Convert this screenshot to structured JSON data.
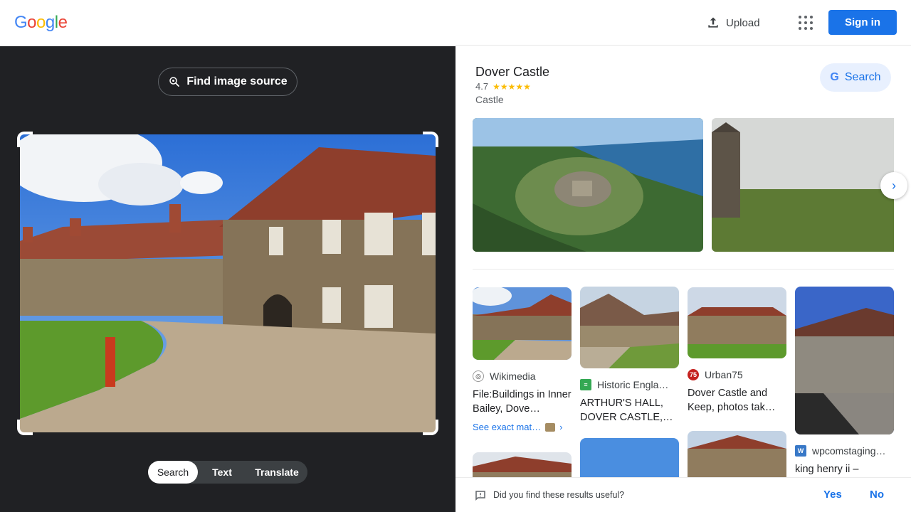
{
  "header": {
    "logo_letters": [
      {
        "ch": "G",
        "color": "#4285F4"
      },
      {
        "ch": "o",
        "color": "#EA4335"
      },
      {
        "ch": "o",
        "color": "#FBBC05"
      },
      {
        "ch": "g",
        "color": "#4285F4"
      },
      {
        "ch": "l",
        "color": "#34A853"
      },
      {
        "ch": "e",
        "color": "#EA4335"
      }
    ],
    "upload_label": "Upload",
    "apps_icon": "apps-grid-icon",
    "signin_label": "Sign in"
  },
  "left": {
    "find_source_label": "Find image source",
    "modes": [
      "Search",
      "Text",
      "Translate"
    ],
    "active_mode": "Search"
  },
  "knowledge_panel": {
    "title": "Dover Castle",
    "rating": "4.7",
    "stars": "★★★★★",
    "type": "Castle",
    "search_label": "Search"
  },
  "results": [
    {
      "source": "Wikimedia",
      "title": "File:Buildings in Inner Bailey, Dove…",
      "exact_label": "See exact mat…",
      "fav_color": "#ffffff",
      "fav_text": "◎"
    },
    {
      "source": "Historic Engla…",
      "title": "ARTHUR'S HALL, DOVER CASTLE,…",
      "fav_color": "#34a853",
      "fav_text": "≡"
    },
    {
      "source": "Urban75",
      "title": "Dover Castle and Keep, photos tak…",
      "fav_color": "#c5221f",
      "fav_text": "75"
    },
    {
      "source": "wpcomstaging…",
      "title": "king henry ii –",
      "fav_color": "#3878c7",
      "fav_text": "W"
    }
  ],
  "feedback": {
    "question": "Did you find these results useful?",
    "yes": "Yes",
    "no": "No"
  },
  "colors": {
    "accent": "#1a73e8",
    "dark_bg": "#202124",
    "star": "#fbbc04"
  }
}
